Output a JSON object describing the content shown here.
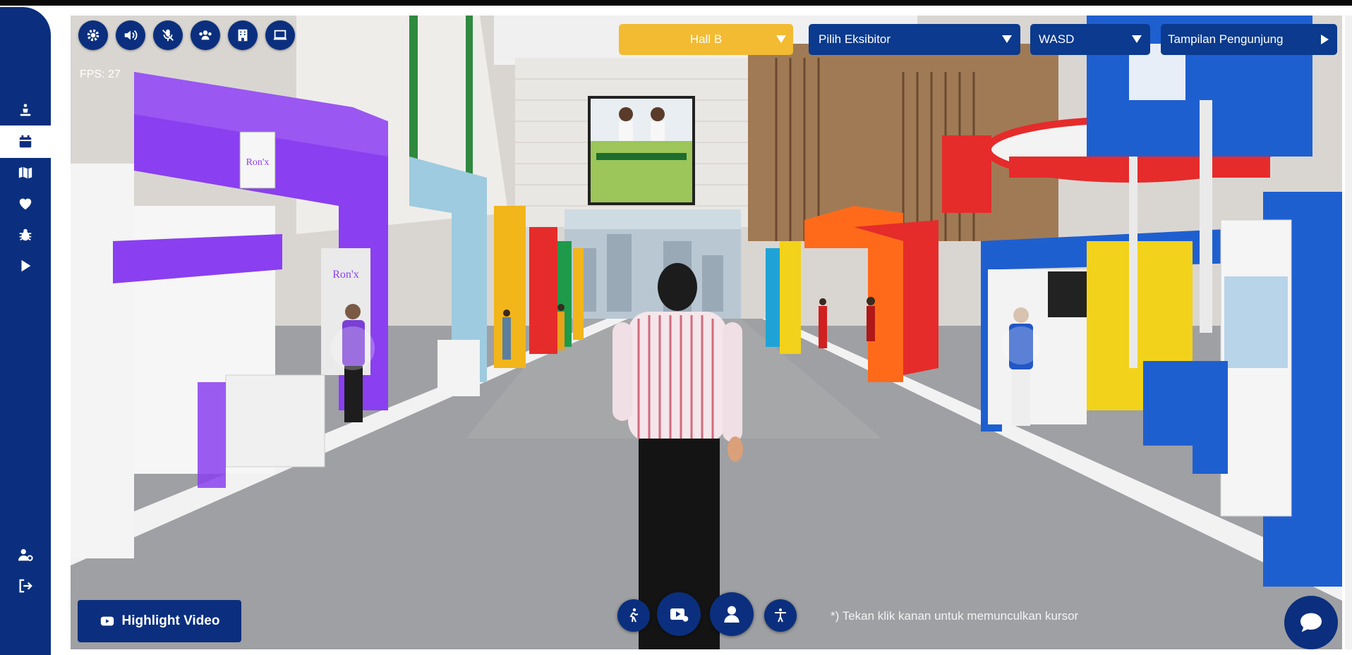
{
  "sidebar": {
    "items": [
      {
        "icon": "person-podium-icon",
        "name": "sidebar-item-podium",
        "active": false
      },
      {
        "icon": "calendar-icon",
        "name": "sidebar-item-calendar",
        "active": true
      },
      {
        "icon": "map-icon",
        "name": "sidebar-item-map",
        "active": false
      },
      {
        "icon": "heart-icon",
        "name": "sidebar-item-favorites",
        "active": false
      },
      {
        "icon": "bug-icon",
        "name": "sidebar-item-bug-report",
        "active": false
      },
      {
        "icon": "play-icon",
        "name": "sidebar-item-play",
        "active": false
      }
    ],
    "bottom_items": [
      {
        "icon": "user-settings-icon",
        "name": "sidebar-item-user-settings"
      },
      {
        "icon": "logout-icon",
        "name": "sidebar-item-logout"
      }
    ]
  },
  "hud": {
    "toolbar_icons": [
      "gear-icon",
      "volume-icon",
      "microphone-off-icon",
      "users-icon",
      "building-icon",
      "monitor-icon"
    ],
    "fps_label": "FPS: 27"
  },
  "dropdowns": {
    "hall": "Hall B",
    "exhibitor": "Pilih Eksibitor",
    "controls": "WASD",
    "view": "Tampilan Pengunjung"
  },
  "bottom": {
    "highlight_label": "Highlight Video",
    "hint": "*) Tekan klik kanan untuk memunculkan kursor",
    "action_icons": [
      "walk-icon",
      "video-play-icon",
      "avatar-icon",
      "accessibility-icon"
    ]
  },
  "scene": {
    "booth_signs": [
      "Ron'x",
      "Ron'x"
    ],
    "colors": {
      "brand_navy": "#0b2f7e",
      "hall_yellow": "#f3bb32",
      "purple_booth": "#8a3ff0",
      "blue_booth": "#1e5fd0",
      "red_booth": "#e8322c",
      "floor": "#9ea0a3"
    }
  }
}
